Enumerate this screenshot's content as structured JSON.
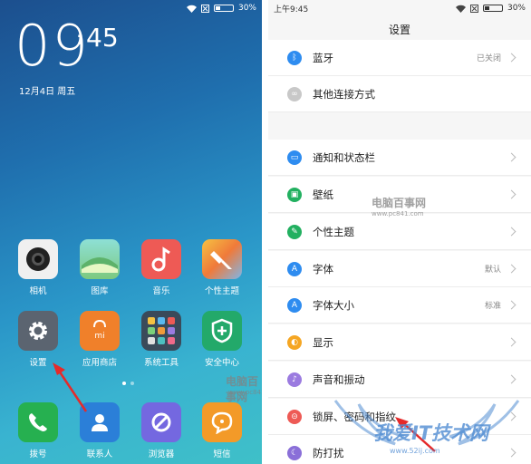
{
  "home": {
    "status": {
      "battery": "30%",
      "battery_level": 0.3
    },
    "clock": {
      "hour": "09",
      "minute": "45"
    },
    "date": "12月4日 周五",
    "apps": [
      {
        "label": "相机",
        "icon": "camera-icon",
        "color": "#f0f0f0"
      },
      {
        "label": "图库",
        "icon": "gallery-icon",
        "color": "#86d4a8"
      },
      {
        "label": "音乐",
        "icon": "music-icon",
        "color": "#ee5a55"
      },
      {
        "label": "个性主题",
        "icon": "theme-brush-icon",
        "color": "#f29a3a"
      },
      {
        "label": "设置",
        "icon": "settings-gear-icon",
        "color": "#5b6470"
      },
      {
        "label": "应用商店",
        "icon": "mi-store-icon",
        "color": "#f0802a"
      },
      {
        "label": "系统工具",
        "icon": "system-tools-folder-icon",
        "color": "#3a4a5a"
      },
      {
        "label": "安全中心",
        "icon": "security-shield-icon",
        "color": "#23a96a"
      }
    ],
    "dock": [
      {
        "label": "拨号",
        "icon": "phone-icon",
        "color": "#26b050"
      },
      {
        "label": "联系人",
        "icon": "contacts-icon",
        "color": "#2b7fd8"
      },
      {
        "label": "浏览器",
        "icon": "browser-icon",
        "color": "#7468e0"
      },
      {
        "label": "短信",
        "icon": "message-icon",
        "color": "#f39a28"
      }
    ],
    "watermark": {
      "title": "电脑百事网",
      "url": "www.pc841.com"
    }
  },
  "settings": {
    "status": {
      "time": "上午9:45",
      "battery": "30%",
      "battery_level": 0.3
    },
    "title": "设置",
    "items": [
      {
        "label": "蓝牙",
        "value": "已关闭",
        "icon": "bluetooth-icon",
        "color": "#2e8cf0",
        "chevron": true
      },
      {
        "label": "其他连接方式",
        "value": "",
        "icon": "link-icon",
        "color": "#c8c8c8",
        "chevron": false
      },
      {
        "label": "通知和状态栏",
        "value": "",
        "icon": "notification-icon",
        "color": "#2e8cf0",
        "chevron": true
      },
      {
        "label": "壁纸",
        "value": "",
        "icon": "wallpaper-icon",
        "color": "#22b060",
        "chevron": true
      },
      {
        "label": "个性主题",
        "value": "",
        "icon": "theme-icon",
        "color": "#22b060",
        "chevron": true
      },
      {
        "label": "字体",
        "value": "默认",
        "icon": "font-icon",
        "color": "#2e8cf0",
        "chevron": true
      },
      {
        "label": "字体大小",
        "value": "标准",
        "icon": "font-size-icon",
        "color": "#2e8cf0",
        "chevron": true
      },
      {
        "label": "显示",
        "value": "",
        "icon": "display-icon",
        "color": "#f5a623",
        "chevron": true
      },
      {
        "label": "声音和振动",
        "value": "",
        "icon": "sound-icon",
        "color": "#9b7be0",
        "chevron": true
      },
      {
        "label": "锁屏、密码和指纹",
        "value": "",
        "icon": "lock-icon",
        "color": "#ee5a55",
        "chevron": true
      },
      {
        "label": "防打扰",
        "value": "",
        "icon": "do-not-disturb-icon",
        "color": "#8a6fd8",
        "chevron": true
      }
    ],
    "watermark_center": {
      "title": "电脑百事网",
      "url": "www.pc841.com"
    },
    "watermark_corner": {
      "title": "我爱IT技术网",
      "url": "www.52ij.com"
    }
  }
}
